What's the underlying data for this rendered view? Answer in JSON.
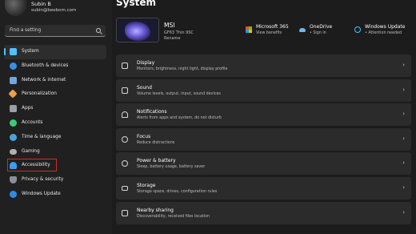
{
  "profile": {
    "name": "Subin B",
    "email": "subin@beebom.com"
  },
  "search": {
    "placeholder": "Find a setting"
  },
  "sidebar": {
    "items": [
      {
        "label": "System",
        "icon": "monitor-icon",
        "color": "#4cc2ff",
        "active": true
      },
      {
        "label": "Bluetooth & devices",
        "icon": "bluetooth-icon",
        "color": "#3a8ee6"
      },
      {
        "label": "Network & internet",
        "icon": "wifi-icon",
        "color": "#6fa8dc"
      },
      {
        "label": "Personalization",
        "icon": "brush-icon",
        "color": "#e8a14d"
      },
      {
        "label": "Apps",
        "icon": "apps-icon",
        "color": "#9aa0a6"
      },
      {
        "label": "Accounts",
        "icon": "person-icon",
        "color": "#3ec97a"
      },
      {
        "label": "Time & language",
        "icon": "globe-clock-icon",
        "color": "#4aa3df"
      },
      {
        "label": "Gaming",
        "icon": "controller-icon",
        "color": "#b0b0b0"
      },
      {
        "label": "Accessibility",
        "icon": "accessibility-icon",
        "color": "#3a9df0",
        "highlighted": true
      },
      {
        "label": "Privacy & security",
        "icon": "shield-icon",
        "color": "#8a8f98"
      },
      {
        "label": "Windows Update",
        "icon": "update-icon",
        "color": "#2f8ae6"
      }
    ]
  },
  "main": {
    "title": "System",
    "device": {
      "name": "MSI",
      "model": "GF63 Thin 9SC",
      "rename": "Rename"
    },
    "apps": [
      {
        "title": "Microsoft 365",
        "sub": "View benefits",
        "icon": "microsoft-logo-icon"
      },
      {
        "title": "OneDrive",
        "sub": "• Sign in",
        "icon": "cloud-icon"
      },
      {
        "title": "Windows Update",
        "sub": "• Attention needed",
        "icon": "update-icon"
      }
    ],
    "cards": [
      {
        "title": "Display",
        "sub": "Monitors, brightness, night light, display profile",
        "icon": "display-icon"
      },
      {
        "title": "Sound",
        "sub": "Volume levels, output, input, sound devices",
        "icon": "speaker-icon"
      },
      {
        "title": "Notifications",
        "sub": "Alerts from apps and system, do not disturb",
        "icon": "bell-icon"
      },
      {
        "title": "Focus",
        "sub": "Reduce distractions",
        "icon": "focus-icon"
      },
      {
        "title": "Power & battery",
        "sub": "Sleep, battery usage, battery saver",
        "icon": "power-icon"
      },
      {
        "title": "Storage",
        "sub": "Storage space, drives, configuration rules",
        "icon": "storage-icon"
      },
      {
        "title": "Nearby sharing",
        "sub": "Discoverability, received files location",
        "icon": "share-icon"
      }
    ],
    "chevron": "›"
  },
  "colors": {
    "accent": "#4cc2ff",
    "highlight_box": "#d42a2a"
  }
}
